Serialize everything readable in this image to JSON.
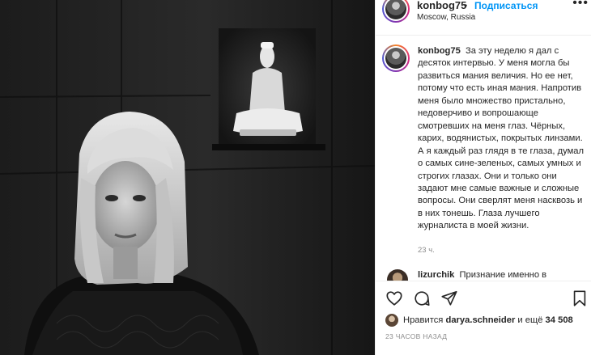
{
  "post": {
    "username": "konbog75",
    "separator": "•",
    "follow_label": "Подписаться",
    "location": "Moscow, Russia",
    "more_label": "•••"
  },
  "caption": {
    "username": "konbog75",
    "text": "За эту неделю я дал с десяток интервью. У меня могла бы развиться мания величия. Но ее нет, потому что есть иная мания. Напротив меня было множество пристально, недоверчиво и вопрошающе смотревших на меня глаз. Чёрных, карих, водянистых, покрытых линзами. А я каждый раз глядя в те глаза, думал о самых сине-зеленых, самых умных и строгих глазах. Они и только они задают мне самые важные и сложные вопросы. Они сверлят меня насквозь и в них тонешь. Глаза лучшего журналиста в моей жизни.",
    "time": "23 ч."
  },
  "comment": {
    "username": "lizurchik",
    "text": "Признание именно в"
  },
  "actions": {
    "icons": [
      "heart-icon",
      "comment-icon",
      "share-icon",
      "bookmark-icon"
    ]
  },
  "likes": {
    "prefix": "Нравится",
    "user": "darya.schneider",
    "middle": "и ещё",
    "count": "34 508"
  },
  "date": "23 ЧАСОВ НАЗАД"
}
